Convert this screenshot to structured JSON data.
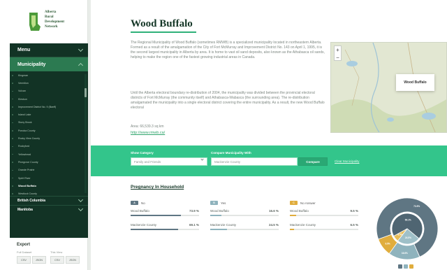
{
  "logo": {
    "lines": [
      "Alberta",
      "Rural",
      "Development",
      "Network"
    ]
  },
  "sidebar": {
    "menu_label": "Menu",
    "municipality_label": "Municipality",
    "municipalities": [
      "Kingman",
      "Vermilion",
      "Vulcan",
      "Kleskun",
      "Improvement District No. 9 (Banff)",
      "Island Lake",
      "Stony Brook",
      "Ponoka County",
      "Rocky View County",
      "Rockyford",
      "Yellowhead",
      "Pinegrove County",
      "Grande Prairie",
      "Spirit River",
      "Wood Buffalo",
      "Westlock County"
    ],
    "active_municipality": "Wood Buffalo",
    "provinces": [
      "British Columbia",
      "Manitoba"
    ],
    "export": {
      "title": "Export",
      "full_dataset_label": "Full Dataset",
      "this_view_label": "This View",
      "buttons": [
        "CSV",
        "JSON",
        "CSV",
        "JSON"
      ]
    }
  },
  "main": {
    "title": "Wood Buffalo",
    "paragraph1": "The Regional Municipality of Wood Buffalo (sometimes RMWB) is a specialized municipality located in northeastern Alberta. Formed as a result of the amalgamation of the City of Fort McMurray and Improvement District No. 143 on April 1, 1995, it is the second largest municipality in Alberta by area. It is home to vast oil sand deposits, also known as the Athabasca oil sands, helping to make the region one of the fastest growing industrial areas in Canada.",
    "paragraph2": "Until the Alberta electoral boundary re-distribution of 2004, the municipality was divided between the provincial electoral districts of Fort McMurray (the community itself) and Athabasca-Wabasca (the surrounding area). The re-distribution amalgamated the municipality into a single electoral district covering the entire municipality. As a result, the new Wood Buffalo electoral",
    "area": "Area: 66,539.3 sq km",
    "link": "http://www.rmwb.ca/",
    "map": {
      "popup_label": "Wood Buffalo",
      "zoom_in": "+",
      "zoom_out": "−"
    }
  },
  "filter": {
    "show_category_label": "Show Category",
    "category_value": "Family and Friends",
    "compare_label": "Compare Municipality With",
    "compare_value": "Mackenzie County",
    "compare_button": "Compare",
    "clear_link": "Clear Municipality"
  },
  "section": {
    "title": "Pregnancy In Household",
    "groups": [
      {
        "pill": "A",
        "label": "No",
        "color": "#5f7683",
        "rows": [
          {
            "name": "Wood Buffalo",
            "value": "73.9 %",
            "pct": 73.9
          },
          {
            "name": "Mackenzie County",
            "value": "69.1 %",
            "pct": 69.1
          }
        ]
      },
      {
        "pill": "B",
        "label": "Yes",
        "color": "#8fb3bd",
        "rows": [
          {
            "name": "Wood Buffalo",
            "value": "16.6 %",
            "pct": 16.6
          },
          {
            "name": "Mackenzie County",
            "value": "24.5 %",
            "pct": 24.5
          }
        ]
      },
      {
        "pill": "C",
        "label": "No Answer",
        "color": "#e0ad3d",
        "rows": [
          {
            "name": "Wood Buffalo",
            "value": "9.5 %",
            "pct": 9.5
          },
          {
            "name": "Mackenzie County",
            "value": "6.5 %",
            "pct": 6.5
          }
        ]
      }
    ],
    "pie_outer": [
      {
        "label": "73.9%",
        "value": 73.9,
        "color": "#5f7683"
      },
      {
        "label": "16.6%",
        "value": 16.6,
        "color": "#8fb3bd"
      },
      {
        "label": "9.5%",
        "value": 9.5,
        "color": "#e0ad3d"
      }
    ],
    "pie_inner": [
      {
        "label": "69.1%",
        "value": 69.1,
        "color": "#4f6572"
      },
      {
        "label": "24.5%",
        "value": 24.5,
        "color": "#9fc0c8"
      },
      {
        "label": "6.5%",
        "value": 6.5,
        "color": "#e8bd57"
      }
    ]
  }
}
